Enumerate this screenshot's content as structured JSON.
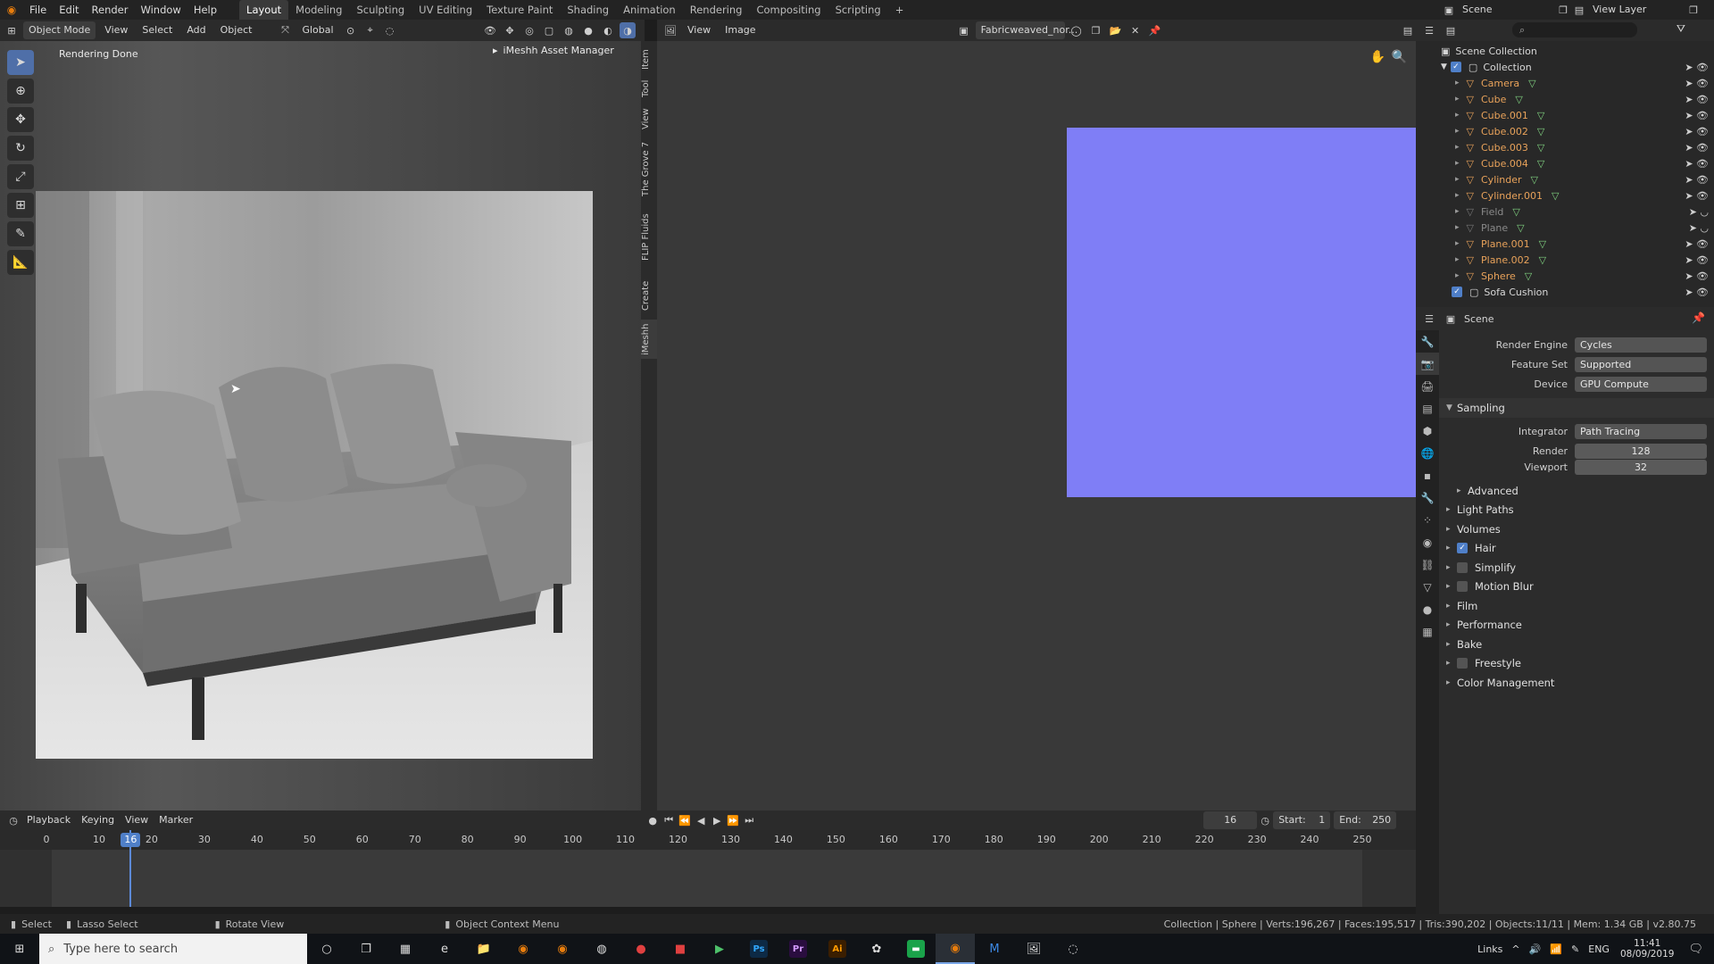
{
  "menu": {
    "items": [
      "File",
      "Edit",
      "Render",
      "Window",
      "Help"
    ]
  },
  "workspaces": {
    "tabs": [
      "Layout",
      "Modeling",
      "Sculpting",
      "UV Editing",
      "Texture Paint",
      "Shading",
      "Animation",
      "Rendering",
      "Compositing",
      "Scripting"
    ],
    "active": "Layout"
  },
  "scene": {
    "scene_name": "Scene",
    "view_layer": "View Layer"
  },
  "viewport": {
    "mode": "Object Mode",
    "menus": [
      "View",
      "Select",
      "Add",
      "Object"
    ],
    "transform": "Global",
    "status_text": "Rendering Done",
    "asset_manager": "iMeshh Asset Manager",
    "side_tabs": [
      "Item",
      "Tool",
      "View",
      "The Grove 7",
      "FLIP Fluids",
      "Create",
      "iMeshh"
    ]
  },
  "image_editor": {
    "menus": [
      "View",
      "Image"
    ],
    "image_name": "Fabricweaved_nor...",
    "normal_color": "#7f7ef6"
  },
  "outliner": {
    "root": "Scene Collection",
    "collection": "Collection",
    "items": [
      {
        "name": "Camera",
        "color": "orange"
      },
      {
        "name": "Cube",
        "color": "orange"
      },
      {
        "name": "Cube.001",
        "color": "orange"
      },
      {
        "name": "Cube.002",
        "color": "orange"
      },
      {
        "name": "Cube.003",
        "color": "orange"
      },
      {
        "name": "Cube.004",
        "color": "orange"
      },
      {
        "name": "Cylinder",
        "color": "orange"
      },
      {
        "name": "Cylinder.001",
        "color": "orange"
      },
      {
        "name": "Field",
        "color": "dim"
      },
      {
        "name": "Plane",
        "color": "dim"
      },
      {
        "name": "Plane.001",
        "color": "orange"
      },
      {
        "name": "Plane.002",
        "color": "orange"
      },
      {
        "name": "Sphere",
        "color": "orange"
      }
    ],
    "extra_collection": "Sofa Cushion"
  },
  "properties": {
    "context": "Scene",
    "render_engine_label": "Render Engine",
    "render_engine": "Cycles",
    "feature_set_label": "Feature Set",
    "feature_set": "Supported",
    "device_label": "Device",
    "device": "GPU Compute",
    "sampling": "Sampling",
    "integrator_label": "Integrator",
    "integrator": "Path Tracing",
    "render_label": "Render",
    "render_samples": "128",
    "viewport_label": "Viewport",
    "viewport_samples": "32",
    "advanced": "Advanced",
    "panels": [
      "Light Paths",
      "Volumes",
      "Hair",
      "Simplify",
      "Motion Blur",
      "Film",
      "Performance",
      "Bake",
      "Freestyle",
      "Color Management"
    ],
    "checked": {
      "Hair": true,
      "Simplify": false,
      "Motion Blur": false,
      "Freestyle": false
    }
  },
  "timeline": {
    "menus": [
      "Playback",
      "Keying",
      "View",
      "Marker"
    ],
    "current_frame": "16",
    "start_label": "Start:",
    "start": "1",
    "end_label": "End:",
    "end": "250",
    "ticks": [
      "0",
      "10",
      "20",
      "30",
      "40",
      "50",
      "60",
      "70",
      "80",
      "90",
      "100",
      "110",
      "120",
      "130",
      "140",
      "150",
      "160",
      "170",
      "180",
      "190",
      "200",
      "210",
      "220",
      "230",
      "240",
      "250"
    ]
  },
  "statusbar": {
    "select": "Select",
    "lasso": "Lasso Select",
    "rotate": "Rotate View",
    "context_menu": "Object Context Menu",
    "stats": "Collection | Sphere | Verts:196,267 | Faces:195,517 | Tris:390,202 | Objects:11/11 | Mem: 1.34 GB | v2.80.75"
  },
  "taskbar": {
    "search_placeholder": "Type here to search",
    "tray": {
      "links": "Links",
      "lang": "ENG",
      "time": "11:41",
      "date": "08/09/2019"
    }
  }
}
